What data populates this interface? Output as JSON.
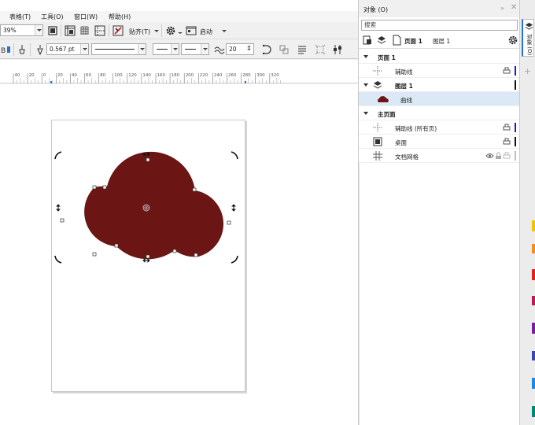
{
  "menubar": {
    "items": [
      "表格(T)",
      "工具(O)",
      "窗口(W)",
      "帮助(H)"
    ]
  },
  "toolbar1": {
    "zoom_value": "39%",
    "snap_label": "贴齐(T)",
    "launch_label": "启动"
  },
  "toolbar2": {
    "outline_width": "0.567 pt",
    "smoothing_value": "20"
  },
  "ruler": {
    "labels": [
      "40",
      "20",
      "0",
      "20",
      "40",
      "60",
      "80",
      "100",
      "120",
      "140",
      "160",
      "180",
      "200",
      "220",
      "240",
      "260",
      "280",
      "300",
      "320"
    ]
  },
  "canvas": {
    "shape_fill": "#6b1515",
    "page_bg": "#ffffff"
  },
  "docker": {
    "title": "对象 (O)",
    "search_placeholder": "搜索",
    "page_tab": "页面 1",
    "layer_tab": "图层 1",
    "tree": [
      {
        "label": "页面 1",
        "bold": true,
        "type": "page"
      },
      {
        "label": "辅助线",
        "type": "guides",
        "color": "#1a1ad6"
      },
      {
        "label": "图层 1",
        "bold": true,
        "type": "layer",
        "color": "#111111"
      },
      {
        "label": "曲线",
        "type": "curve",
        "selected": true
      },
      {
        "label": "主页面",
        "bold": true,
        "type": "page"
      },
      {
        "label": "辅助线 (所有页)",
        "type": "guides",
        "color": "#1a1ad6"
      },
      {
        "label": "桌面",
        "type": "desktop",
        "color": "#111111"
      },
      {
        "label": "文档网格",
        "type": "grid",
        "color": "#c0c0c0"
      }
    ]
  },
  "tabstrip": {
    "tab_label": "对象 (O)",
    "accent": "#2a6fd1"
  }
}
